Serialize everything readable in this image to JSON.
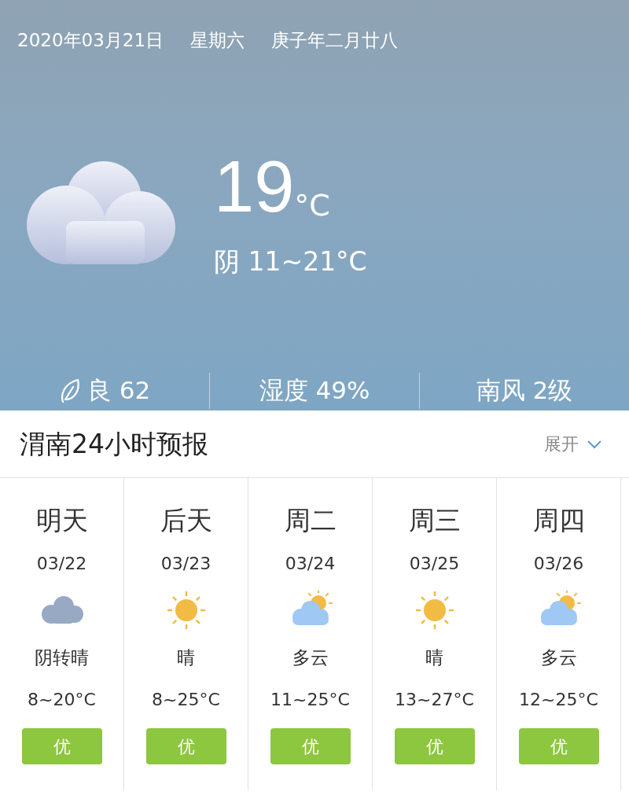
{
  "header": {
    "date": "2020年03月21日",
    "weekday": "星期六",
    "lunar": "庚子年二月廿八"
  },
  "current": {
    "kind": "overcast",
    "temp": "19",
    "unit": "°C",
    "summary": "阴 11~21°C"
  },
  "stats": [
    {
      "kind": "air",
      "text": "良 62"
    },
    {
      "kind": "plain",
      "text": "湿度 49%"
    },
    {
      "kind": "plain",
      "text": "南风 2级"
    }
  ],
  "forecast": {
    "title": "渭南24小时预报",
    "expand": "展开",
    "days": [
      {
        "day": "明天",
        "date": "03/22",
        "kind": "overcast",
        "weather": "阴转晴",
        "temp": "8~20°C",
        "aqi": "优"
      },
      {
        "day": "后天",
        "date": "03/23",
        "kind": "sunny",
        "weather": "晴",
        "temp": "8~25°C",
        "aqi": "优"
      },
      {
        "day": "周二",
        "date": "03/24",
        "kind": "partly",
        "weather": "多云",
        "temp": "11~25°C",
        "aqi": "优"
      },
      {
        "day": "周三",
        "date": "03/25",
        "kind": "sunny",
        "weather": "晴",
        "temp": "13~27°C",
        "aqi": "优"
      },
      {
        "day": "周四",
        "date": "03/26",
        "kind": "partly",
        "weather": "多云",
        "temp": "12~25°C",
        "aqi": "优"
      }
    ]
  }
}
